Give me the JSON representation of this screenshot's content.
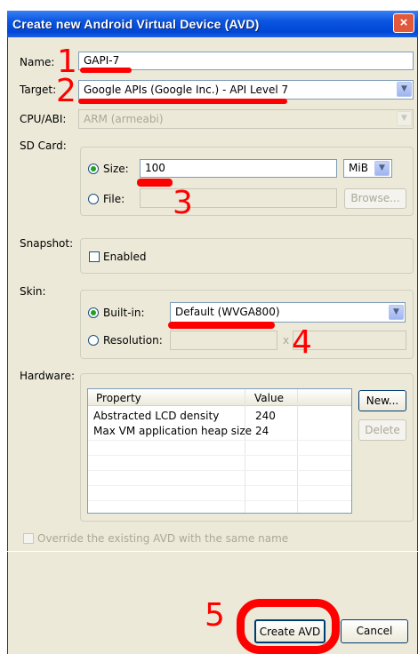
{
  "window": {
    "title": "Create new Android Virtual Device (AVD)",
    "close_label": "×"
  },
  "form": {
    "name_label": "Name:",
    "name_value": "GAPI-7",
    "target_label": "Target:",
    "target_value": "Google APIs (Google Inc.) - API Level 7",
    "cpu_label": "CPU/ABI:",
    "cpu_value": "ARM (armeabi)",
    "sdcard_label": "SD Card:",
    "size_label": "Size:",
    "size_value": "100",
    "size_unit": "MiB",
    "file_label": "File:",
    "browse_label": "Browse...",
    "snapshot_label": "Snapshot:",
    "enabled_label": "Enabled",
    "skin_label": "Skin:",
    "builtin_label": "Built-in:",
    "builtin_value": "Default (WVGA800)",
    "resolution_label": "Resolution:",
    "resolution_x": "x",
    "hardware_label": "Hardware:",
    "override_label": "Override the existing AVD with the same name"
  },
  "hardware_table": {
    "columns": [
      "Property",
      "Value"
    ],
    "rows": [
      {
        "property": "Abstracted LCD density",
        "value": "240"
      },
      {
        "property": "Max VM application heap size",
        "value": "24"
      }
    ],
    "new_label": "New...",
    "delete_label": "Delete"
  },
  "footer": {
    "create_label": "Create AVD",
    "cancel_label": "Cancel"
  },
  "annotations": {
    "n1": "1",
    "n2": "2",
    "n3": "3",
    "n4": "4",
    "n5": "5",
    "color": "#ff0000"
  }
}
